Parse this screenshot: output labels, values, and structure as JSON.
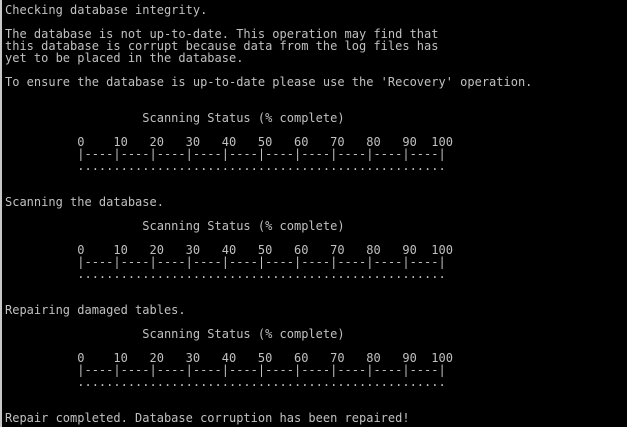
{
  "console": {
    "foreground": "#c0c0c0",
    "background": "#000000",
    "lines": {
      "checking": "Checking database integrity.",
      "warn1": "The database is not up-to-date. This operation may find that",
      "warn2": "this database is corrupt because data from the log files has",
      "warn3": "yet to be placed in the database.",
      "ensure": "To ensure the database is up-to-date please use the 'Recovery' operation.",
      "status1_title": "                   Scanning Status (% complete)",
      "status1_scale": "          0    10   20   30   40   50   60   70   80   90  100",
      "status1_ruler": "          |----|----|----|----|----|----|----|----|----|----|",
      "status1_progress": "          ...................................................",
      "scanning": "Scanning the database.",
      "status2_title": "                   Scanning Status (% complete)",
      "status2_scale": "          0    10   20   30   40   50   60   70   80   90  100",
      "status2_ruler": "          |----|----|----|----|----|----|----|----|----|----|",
      "status2_progress": "          ...................................................",
      "repairing": "Repairing damaged tables.",
      "status3_title": "                   Scanning Status (% complete)",
      "status3_scale": "          0    10   20   30   40   50   60   70   80   90  100",
      "status3_ruler": "          |----|----|----|----|----|----|----|----|----|----|",
      "status3_progress": "          ...................................................",
      "completed": "Repair completed. Database corruption has been repaired!"
    }
  }
}
